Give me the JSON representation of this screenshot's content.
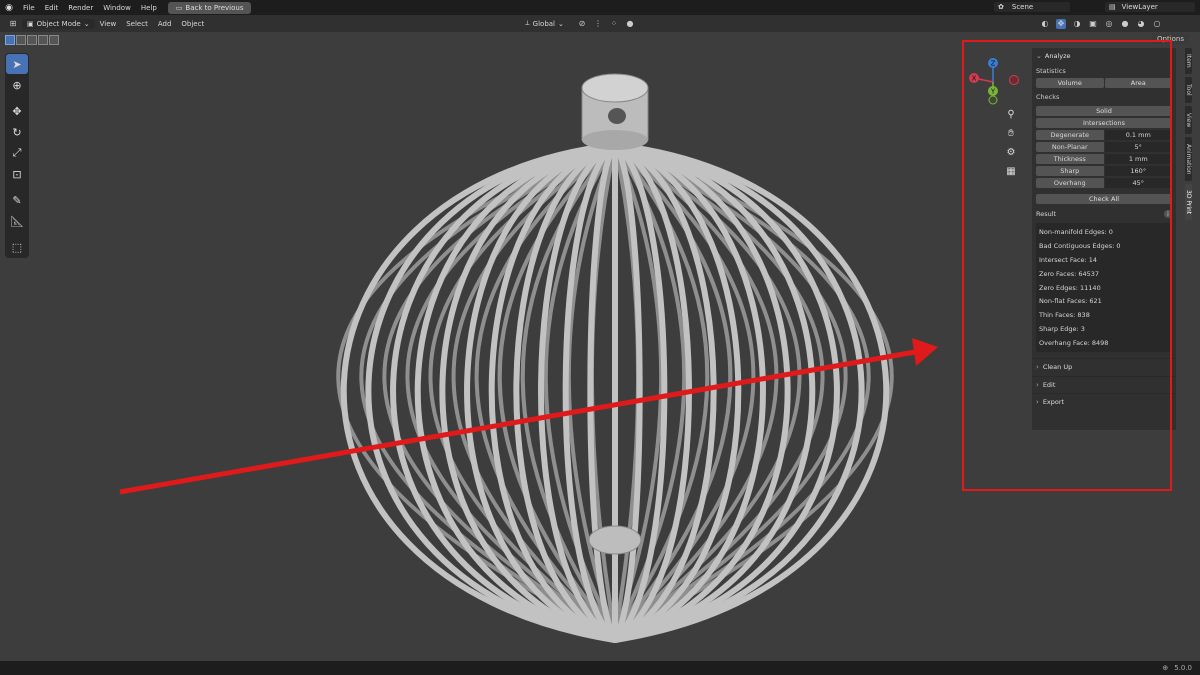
{
  "topbar": {
    "menus": [
      "File",
      "Edit",
      "Render",
      "Window",
      "Help"
    ],
    "back_button": "Back to Previous",
    "scene": "Scene",
    "view_layer": "ViewLayer"
  },
  "header": {
    "mode": "Object Mode",
    "menus": [
      "View",
      "Select",
      "Add",
      "Object"
    ],
    "orientation": "Global",
    "options": "Options"
  },
  "sidebar": {
    "analyze": {
      "title": "Analyze",
      "statistics_label": "Statistics",
      "volume": "Volume",
      "area": "Area",
      "checks_label": "Checks",
      "solid": "Solid",
      "intersections": "Intersections",
      "checks": [
        {
          "label": "Degenerate",
          "value": "0.1 mm"
        },
        {
          "label": "Non-Planar",
          "value": "5°"
        },
        {
          "label": "Thickness",
          "value": "1 mm"
        },
        {
          "label": "Sharp",
          "value": "160°"
        },
        {
          "label": "Overhang",
          "value": "45°"
        }
      ],
      "check_all": "Check All",
      "result_label": "Result",
      "results": [
        "Non-manifold Edges: 0",
        "Bad Contiguous Edges: 0",
        "Intersect Face: 14",
        "Zero Faces: 64537",
        "Zero Edges: 11140",
        "Non-flat Faces: 621",
        "Thin Faces: 838",
        "Sharp Edge: 3",
        "Overhang Face: 8498"
      ]
    },
    "collapsed_panels": [
      "Clean Up",
      "Edit",
      "Export"
    ],
    "tabs": [
      "Item",
      "Tool",
      "View",
      "Animation",
      "3D Print"
    ]
  },
  "gizmo": {
    "x": "X",
    "y": "Y",
    "z": "Z"
  },
  "status": {
    "version": "5.0.0"
  },
  "colors": {
    "highlight": "#e01a1a",
    "arrow": "#e01a1a",
    "accent": "#4772b3"
  }
}
